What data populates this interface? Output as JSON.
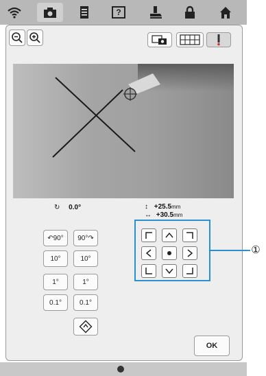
{
  "tabs": [
    {
      "icon": "wifi-icon"
    },
    {
      "icon": "camera-icon",
      "active": true
    },
    {
      "icon": "document-icon"
    },
    {
      "icon": "help-icon",
      "label": "?"
    },
    {
      "icon": "presser-foot-icon"
    },
    {
      "icon": "lock-icon"
    },
    {
      "icon": "home-icon"
    }
  ],
  "zoom": {
    "out_icon": "zoom-out-icon",
    "in_icon": "zoom-in-icon"
  },
  "view": {
    "camera_view_icon": "camera-view-icon",
    "grid_icon": "grid-icon",
    "needle_icon": "needle-icon"
  },
  "readouts": {
    "rotation_symbol": "↻",
    "rotation_value": "0.0°",
    "vertical_value": "+25.5",
    "vertical_unit": "mm",
    "horizontal_value": "+30.5",
    "horizontal_unit": "mm"
  },
  "rotate_buttons": [
    {
      "left": "↶90°",
      "right": "90°↷"
    },
    {
      "left": "10°",
      "right": "10°"
    },
    {
      "left": "1°",
      "right": "1°"
    },
    {
      "left": "0.1°",
      "right": "0.1°"
    }
  ],
  "arrows": [
    "⌜",
    "^",
    "⌝",
    "<",
    "•",
    ">",
    "⌞",
    "v",
    "⌟"
  ],
  "ok_label": "OK",
  "callout_label": "①"
}
